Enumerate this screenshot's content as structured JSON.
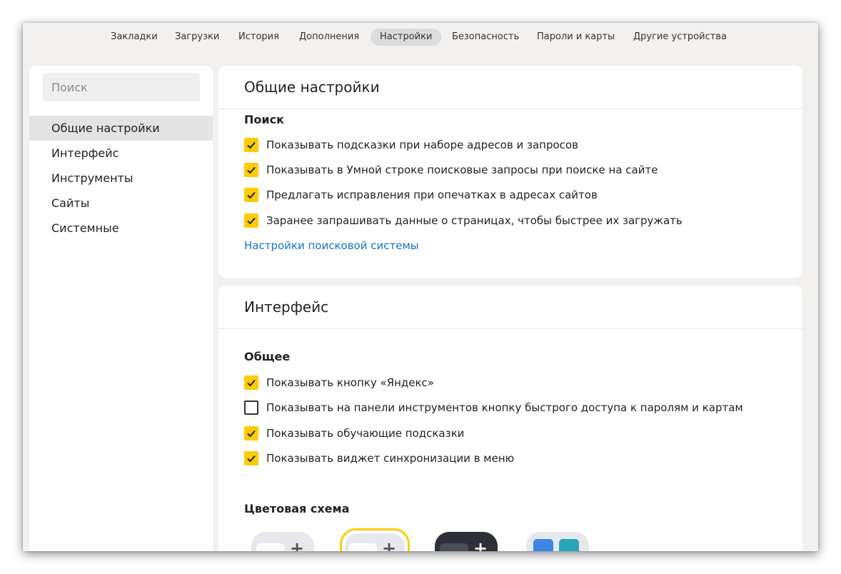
{
  "nav": {
    "items": [
      {
        "label": "Закладки"
      },
      {
        "label": "Загрузки"
      },
      {
        "label": "История"
      },
      {
        "label": "Дополнения"
      },
      {
        "label": "Настройки",
        "active": true
      },
      {
        "label": "Безопасность"
      },
      {
        "label": "Пароли и карты"
      },
      {
        "label": "Другие устройства"
      }
    ]
  },
  "sidebar": {
    "search_placeholder": "Поиск",
    "items": [
      {
        "label": "Общие настройки",
        "active": true
      },
      {
        "label": "Интерфейс"
      },
      {
        "label": "Инструменты"
      },
      {
        "label": "Сайты"
      },
      {
        "label": "Системные"
      }
    ]
  },
  "general": {
    "title": "Общие настройки",
    "search_heading": "Поиск",
    "options": [
      {
        "label": "Показывать подсказки при наборе адресов и запросов",
        "checked": true
      },
      {
        "label": "Показывать в Умной строке поисковые запросы при поиске на сайте",
        "checked": true
      },
      {
        "label": "Предлагать исправления при опечатках в адресах сайтов",
        "checked": true
      },
      {
        "label": "Заранее запрашивать данные о страницах, чтобы быстрее их загружать",
        "checked": true
      }
    ],
    "link": "Настройки поисковой системы"
  },
  "interface": {
    "title": "Интерфейс",
    "common_heading": "Общее",
    "options": [
      {
        "label": "Показывать кнопку «Яндекс»",
        "checked": true
      },
      {
        "label": "Показывать на панели инструментов кнопку быстрого доступа к паролям и картам",
        "checked": false
      },
      {
        "label": "Показывать обучающие подсказки",
        "checked": true
      },
      {
        "label": "Показывать виджет синхронизации в меню",
        "checked": true
      }
    ],
    "color_scheme_heading": "Цветовая схема",
    "themes": [
      {
        "name": "light",
        "selected": false,
        "plus": "+"
      },
      {
        "name": "light",
        "selected": true,
        "plus": "+"
      },
      {
        "name": "dark",
        "selected": false,
        "plus": "+"
      },
      {
        "name": "colored",
        "selected": false,
        "plus": "+"
      }
    ]
  },
  "colors": {
    "accent": "#ffcc00",
    "link": "#1a73c2",
    "window_bg": "#f2f1ef"
  }
}
